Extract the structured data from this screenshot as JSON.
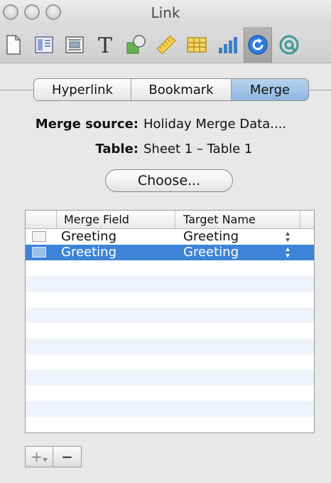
{
  "window": {
    "title": "Link"
  },
  "toolbar": {
    "icons": [
      "document-icon",
      "layout-icon",
      "wrap-icon",
      "text-icon",
      "shapes-icon",
      "ruler-icon",
      "table-icon",
      "chart-icon",
      "link-icon",
      "comment-icon"
    ],
    "active": "link-icon",
    "accent": "#3d84d8"
  },
  "tabs": [
    "Hyperlink",
    "Bookmark",
    "Merge"
  ],
  "selected_tab": "Merge",
  "merge": {
    "source_label": "Merge source:",
    "source_value": "Holiday Merge Data....",
    "table_label": "Table:",
    "table_value": "Sheet 1 – Table 1",
    "choose_label": "Choose..."
  },
  "table": {
    "columns": [
      "Merge Field",
      "Target Name"
    ],
    "rows": [
      {
        "field": "Greeting",
        "target": "Greeting",
        "selected": false
      },
      {
        "field": "Greeting",
        "target": "Greeting",
        "selected": true
      }
    ]
  },
  "bottom": {
    "add_label": "+",
    "remove_label": "−"
  }
}
